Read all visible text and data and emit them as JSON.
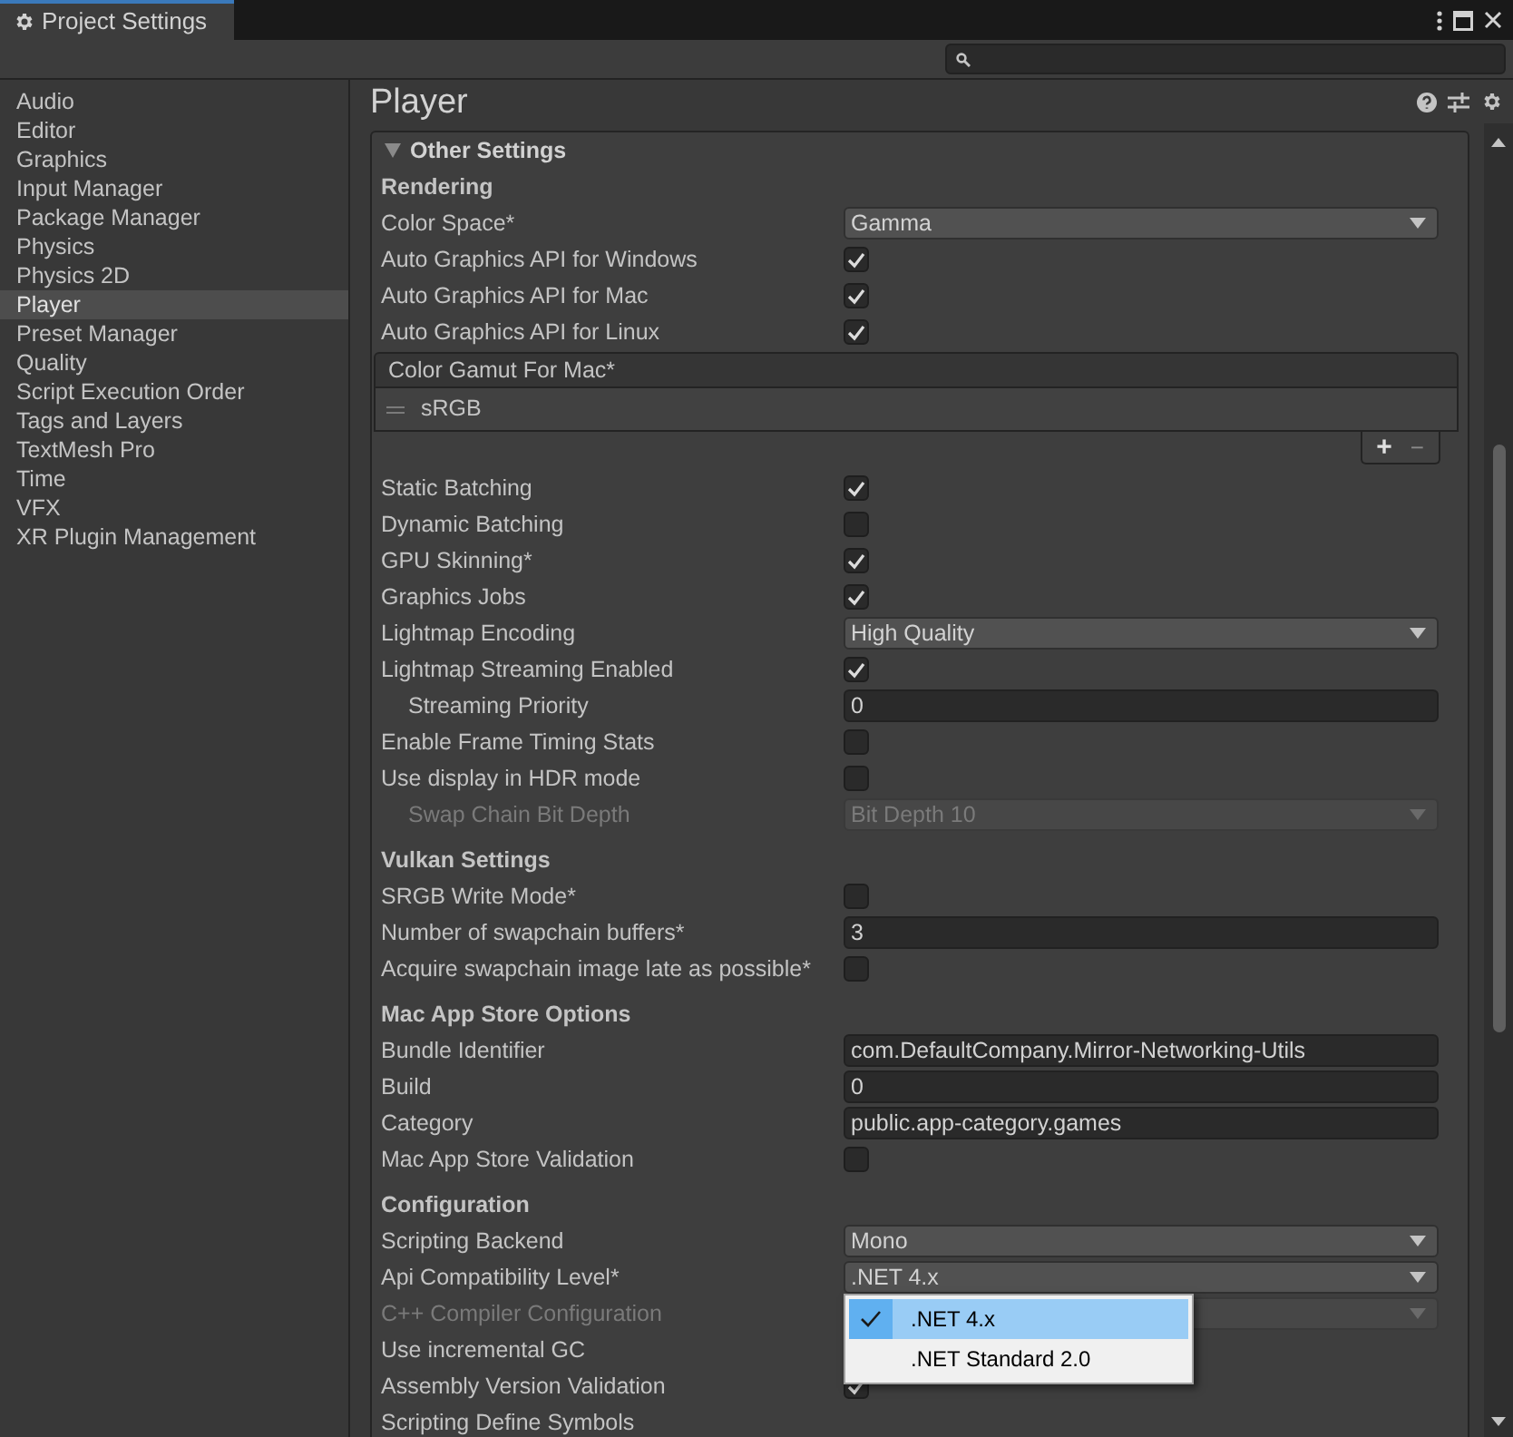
{
  "window": {
    "title": "Project Settings"
  },
  "sidebar": {
    "items": [
      {
        "label": "Audio",
        "selected": false
      },
      {
        "label": "Editor",
        "selected": false
      },
      {
        "label": "Graphics",
        "selected": false
      },
      {
        "label": "Input Manager",
        "selected": false
      },
      {
        "label": "Package Manager",
        "selected": false
      },
      {
        "label": "Physics",
        "selected": false
      },
      {
        "label": "Physics 2D",
        "selected": false
      },
      {
        "label": "Player",
        "selected": true
      },
      {
        "label": "Preset Manager",
        "selected": false
      },
      {
        "label": "Quality",
        "selected": false
      },
      {
        "label": "Script Execution Order",
        "selected": false
      },
      {
        "label": "Tags and Layers",
        "selected": false
      },
      {
        "label": "TextMesh Pro",
        "selected": false
      },
      {
        "label": "Time",
        "selected": false
      },
      {
        "label": "VFX",
        "selected": false
      },
      {
        "label": "XR Plugin Management",
        "selected": false
      }
    ]
  },
  "panel": {
    "title": "Player",
    "section": {
      "title": "Other Settings",
      "expanded": true
    },
    "rows": [
      {
        "kind": "heading",
        "label": "Rendering"
      },
      {
        "kind": "dropdown",
        "label": "Color Space*",
        "value": "Gamma"
      },
      {
        "kind": "check",
        "label": "Auto Graphics API  for Windows",
        "checked": true
      },
      {
        "kind": "check",
        "label": "Auto Graphics API  for Mac",
        "checked": true
      },
      {
        "kind": "check",
        "label": "Auto Graphics API  for Linux",
        "checked": true
      },
      {
        "kind": "list",
        "label": "Color Gamut For Mac*",
        "items": [
          "sRGB"
        ],
        "add": "+",
        "remove": "−"
      },
      {
        "kind": "check",
        "label": "Static Batching",
        "checked": true
      },
      {
        "kind": "check",
        "label": "Dynamic Batching",
        "checked": false
      },
      {
        "kind": "check",
        "label": "GPU Skinning*",
        "checked": true
      },
      {
        "kind": "check",
        "label": "Graphics Jobs",
        "checked": true
      },
      {
        "kind": "dropdown",
        "label": "Lightmap Encoding",
        "value": "High Quality"
      },
      {
        "kind": "check",
        "label": "Lightmap Streaming Enabled",
        "checked": true
      },
      {
        "kind": "text",
        "label": "Streaming Priority",
        "value": "0",
        "indent": true
      },
      {
        "kind": "check",
        "label": "Enable Frame Timing Stats",
        "checked": false
      },
      {
        "kind": "check",
        "label": "Use display in HDR mode",
        "checked": false
      },
      {
        "kind": "dropdown",
        "label": "Swap Chain Bit Depth",
        "value": "Bit Depth 10",
        "indent": true,
        "disabled": true
      },
      {
        "kind": "heading",
        "label": "Vulkan Settings"
      },
      {
        "kind": "check",
        "label": "SRGB Write Mode*",
        "checked": false
      },
      {
        "kind": "text",
        "label": "Number of swapchain buffers*",
        "value": "3"
      },
      {
        "kind": "check",
        "label": "Acquire swapchain image late as possible*",
        "checked": false
      },
      {
        "kind": "heading",
        "label": "Mac App Store Options"
      },
      {
        "kind": "text",
        "label": "Bundle Identifier",
        "value": "com.DefaultCompany.Mirror-Networking-Utils"
      },
      {
        "kind": "text",
        "label": "Build",
        "value": "0"
      },
      {
        "kind": "text",
        "label": "Category",
        "value": "public.app-category.games"
      },
      {
        "kind": "check",
        "label": "Mac App Store Validation",
        "checked": false
      },
      {
        "kind": "heading",
        "label": "Configuration"
      },
      {
        "kind": "dropdown",
        "label": "Scripting Backend",
        "value": "Mono"
      },
      {
        "kind": "dropdown",
        "label": "Api Compatibility Level*",
        "value": ".NET 4.x",
        "popup": [
          {
            "label": ".NET 4.x",
            "selected": true
          },
          {
            "label": ".NET Standard 2.0",
            "selected": false
          }
        ]
      },
      {
        "kind": "dropdown",
        "label": "C++ Compiler Configuration",
        "disabled": true
      },
      {
        "kind": "label",
        "label": "Use incremental GC"
      },
      {
        "kind": "check",
        "label": "Assembly Version Validation",
        "checked": true
      },
      {
        "kind": "label",
        "label": "Scripting Define Symbols"
      }
    ]
  }
}
